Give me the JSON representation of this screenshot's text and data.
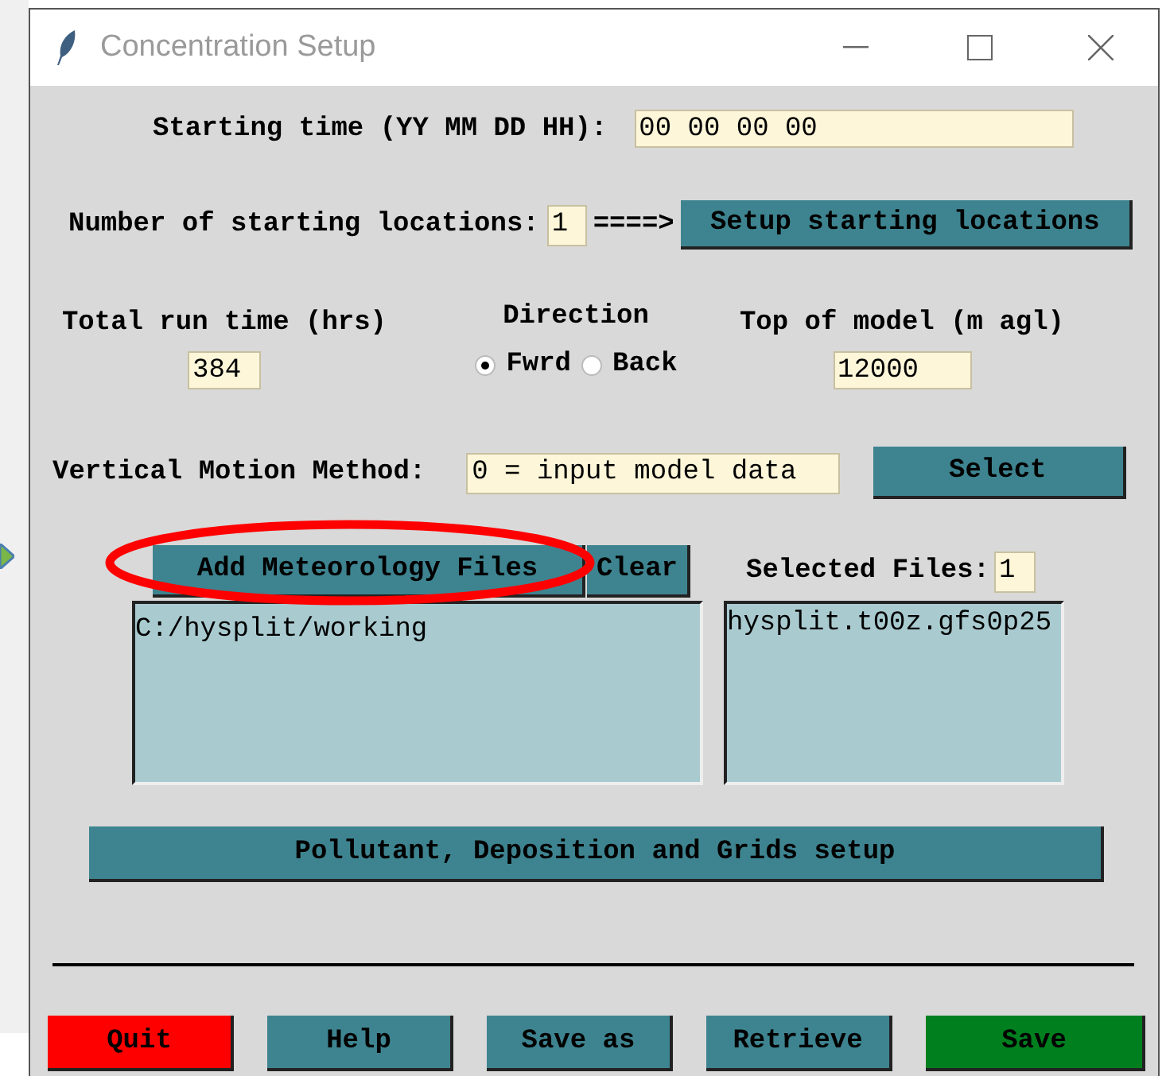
{
  "window": {
    "title": "Concentration Setup"
  },
  "starting_time": {
    "label": "Starting time (YY MM DD HH):",
    "value": "00 00 00 00"
  },
  "starting_locations": {
    "label": "Number of starting locations:",
    "value": "1",
    "arrow": "====>",
    "button": "Setup starting locations"
  },
  "run_time": {
    "label": "Total run time (hrs)",
    "value": "384"
  },
  "direction": {
    "label": "Direction",
    "options": [
      {
        "label": "Fwrd",
        "selected": true
      },
      {
        "label": "Back",
        "selected": false
      }
    ]
  },
  "top_of_model": {
    "label": "Top of model (m agl)",
    "value": "12000"
  },
  "vertical_motion": {
    "label": "Vertical Motion Method:",
    "value": "0 = input model data",
    "button": "Select"
  },
  "meteorology": {
    "add_button": "Add Meteorology Files",
    "clear_button": "Clear",
    "selected_label": "Selected Files:",
    "selected_count": "1",
    "directories": [
      "C:/hysplit/working"
    ],
    "files": [
      "hysplit.t00z.gfs0p25"
    ]
  },
  "setup_button": "Pollutant, Deposition and Grids setup",
  "buttons": [
    {
      "label": "Quit",
      "color": "#ff0000"
    },
    {
      "label": "Help",
      "color": "#3e8490"
    },
    {
      "label": "Save as",
      "color": "#3e8490"
    },
    {
      "label": "Retrieve",
      "color": "#3e8490"
    },
    {
      "label": "Save",
      "color": "#007f1f"
    }
  ]
}
